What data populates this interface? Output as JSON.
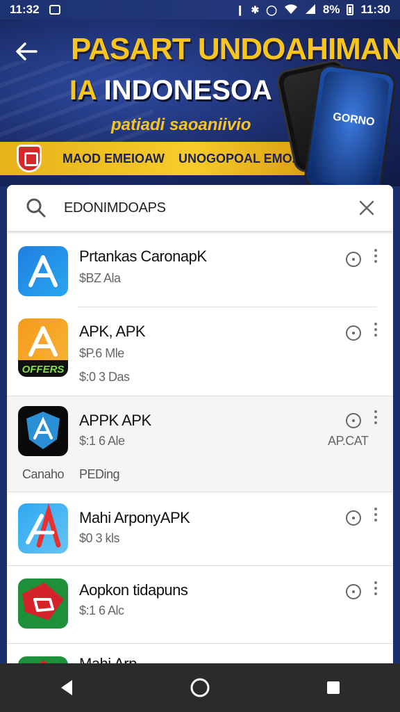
{
  "status_bar": {
    "time_left": "11:32",
    "battery": "8%",
    "time_right": "11:30"
  },
  "banner": {
    "title_line1": "PASART UNDOAHIMAN",
    "title_line2_prefix": "IA",
    "title_line2_rest": "INDONESOA",
    "subtitle": "patiadi saoaniivio",
    "ribbon_text1": "MAOD EMEIOAW",
    "ribbon_text2": "UNOGOPOAL EMOAEN",
    "phone_label": "GORNO"
  },
  "search": {
    "query": "EDONIMDOAPS"
  },
  "apps": [
    {
      "title": "Prtankas CaronapK",
      "meta1": "$BZ Ala",
      "icon_colors": [
        "#1f7fe0",
        "#29a6f0"
      ],
      "icon_name": "app-store-a-icon"
    },
    {
      "title": "APK, APK",
      "meta1": "$P.6 Mle",
      "meta2": "$:0 3 Das",
      "icon_colors": [
        "#f59a1a",
        "#f7b53b"
      ],
      "badge": "OFFERS",
      "icon_name": "app-store-a-icon"
    },
    {
      "title": "APPK APK",
      "meta1": "$:1 6 Ale",
      "status_cat": "AP.CAT",
      "left_label": "Canaho",
      "status_label": "PEDing",
      "icon_colors": [
        "#0e1f2e",
        "#1b3b55"
      ],
      "icon_name": "app-shield-a-icon"
    },
    {
      "title": "Mahi ArponyAPK",
      "meta1": "$0 3 kls",
      "icon_colors": [
        "#2ea8f0",
        "#65c4f5"
      ],
      "icon_name": "app-store-a-icon"
    },
    {
      "title": "Aopkon tidapuns",
      "meta1": "$:1 6 Alc",
      "icon_colors": [
        "#1e8f3a",
        "#d3222a"
      ],
      "icon_name": "app-tag-icon"
    },
    {
      "title": "Mahi Arp",
      "meta1": "",
      "icon_colors": [
        "#1e8f3a",
        "#d3222a"
      ],
      "icon_name": "app-tag-icon"
    }
  ],
  "nav": {
    "back": "back-icon",
    "home": "home-icon",
    "recents": "recents-icon"
  }
}
